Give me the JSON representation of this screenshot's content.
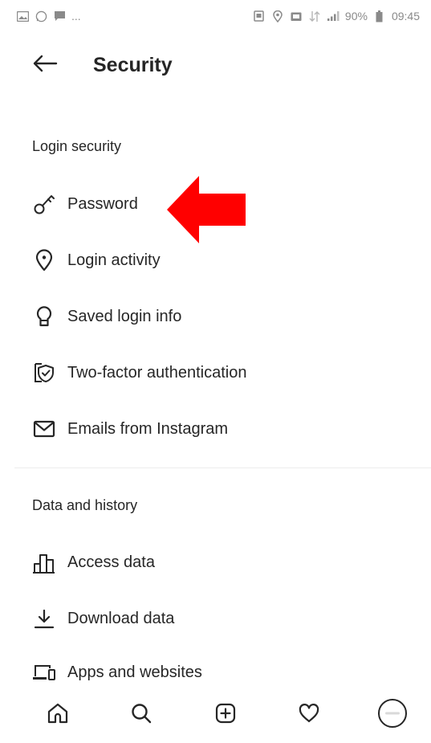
{
  "status_bar": {
    "left_icons": [
      "gallery-icon",
      "whatsapp-icon",
      "message-icon"
    ],
    "ellipsis": "...",
    "right_icons": [
      "screenshot-icon",
      "location-icon",
      "wallet-icon",
      "data-icon",
      "signal-icon"
    ],
    "battery": "90%",
    "time": "09:45"
  },
  "header": {
    "title": "Security",
    "back_icon": "arrow-left-icon"
  },
  "sections": [
    {
      "title": "Login security",
      "items": [
        {
          "label": "Password",
          "icon": "key-icon"
        },
        {
          "label": "Login activity",
          "icon": "location-pin-icon"
        },
        {
          "label": "Saved login info",
          "icon": "keyhole-icon"
        },
        {
          "label": "Two-factor authentication",
          "icon": "shield-check-icon"
        },
        {
          "label": "Emails from Instagram",
          "icon": "envelope-icon"
        }
      ]
    },
    {
      "title": "Data and history",
      "items": [
        {
          "label": "Access data",
          "icon": "bar-chart-icon"
        },
        {
          "label": "Download data",
          "icon": "download-icon"
        },
        {
          "label": "Apps and websites",
          "icon": "devices-icon"
        }
      ]
    }
  ],
  "annotation": {
    "type": "arrow",
    "color": "#ff0000",
    "points_to": "Password"
  },
  "bottom_nav": {
    "items": [
      "home-icon",
      "search-icon",
      "new-post-icon",
      "activity-heart-icon",
      "profile-avatar-icon"
    ]
  },
  "colors": {
    "text": "#262626",
    "status_text": "#8a8a8a",
    "annotation": "#ff0000",
    "divider": "#ececec"
  }
}
